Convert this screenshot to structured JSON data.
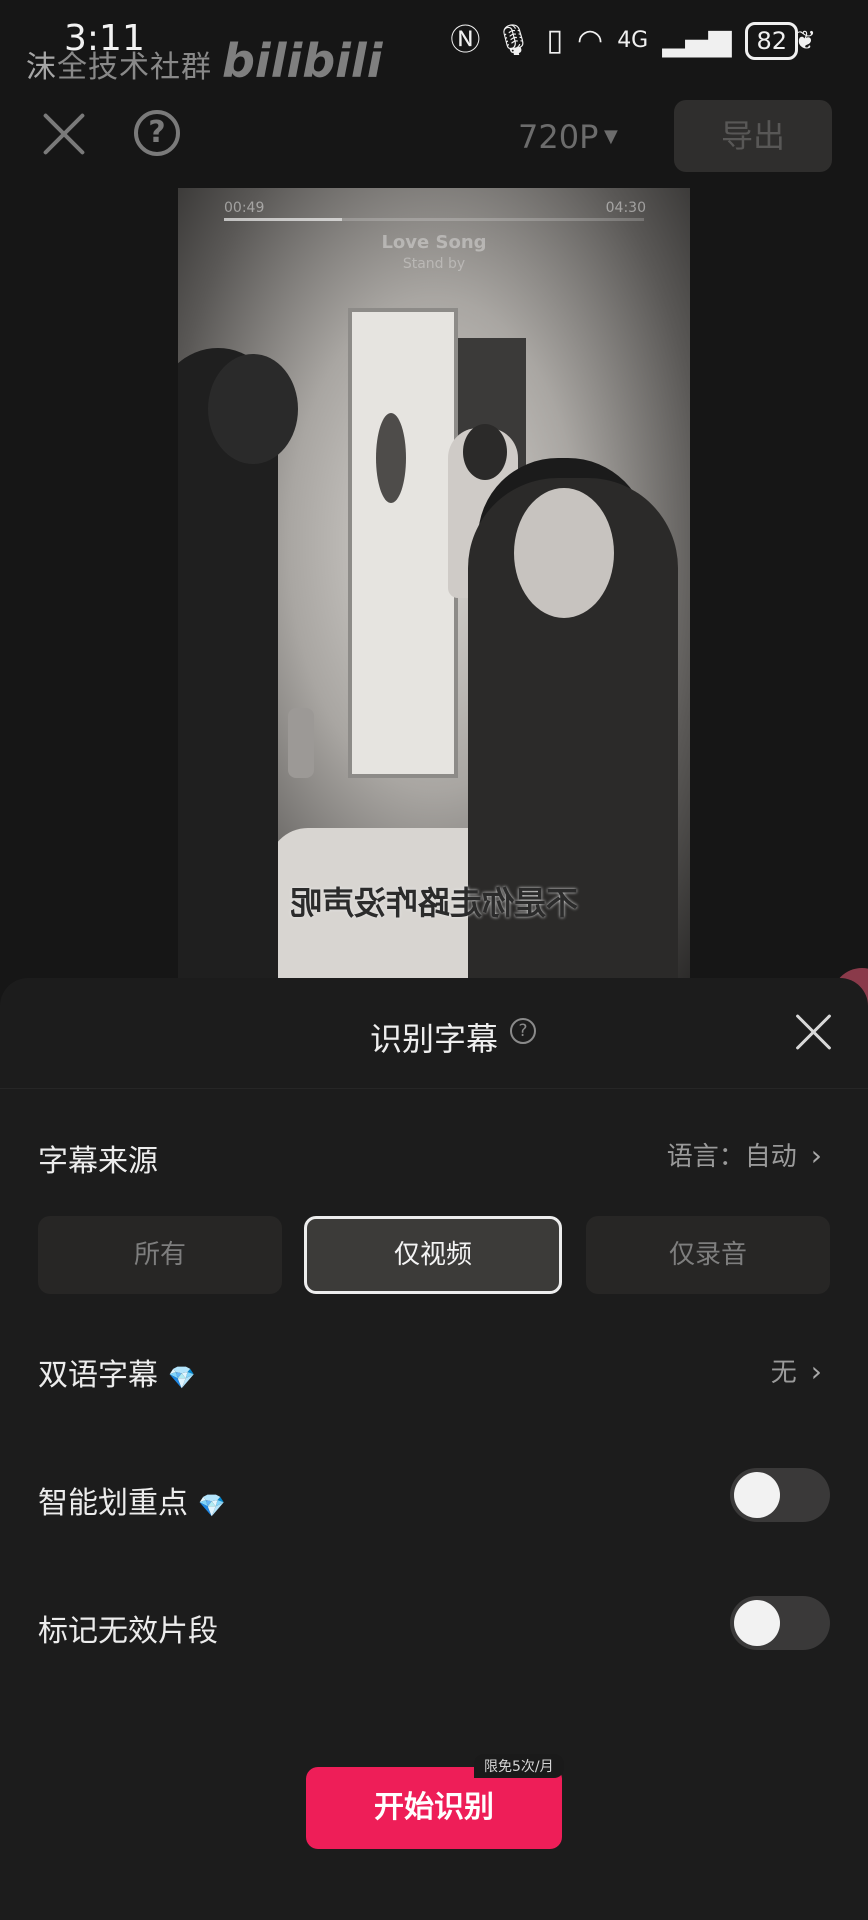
{
  "status_bar": {
    "time": "3:11",
    "watermark": "沫",
    "bili_logo": "bilibili",
    "battery": "82",
    "network": "4G"
  },
  "toolbar": {
    "resolution": "720P",
    "export_label": "导出"
  },
  "video": {
    "time_start": "00:49",
    "time_end": "04:30",
    "song_title": "Love Song",
    "song_subtitle": "Stand by",
    "subtitle": "不是你走路咋没声呢",
    "music_progress": 0.28
  },
  "sheet": {
    "title": "识别字幕",
    "source_label": "字幕来源",
    "language_value": "语言：自动",
    "source_options": [
      {
        "label": "所有",
        "selected": false
      },
      {
        "label": "仅视频",
        "selected": true
      },
      {
        "label": "仅录音",
        "selected": false
      }
    ],
    "bilingual_label": "双语字幕",
    "bilingual_value": "无",
    "highlight_label": "智能划重点",
    "highlight_enabled": false,
    "invalid_label": "标记无效片段",
    "invalid_enabled": false,
    "start_label": "开始识别",
    "quota_badge": "限免5次/月"
  },
  "colors": {
    "accent": "#ee1e58",
    "sheet_bg": "#1c1c1c",
    "selected_border": "#ededed"
  }
}
